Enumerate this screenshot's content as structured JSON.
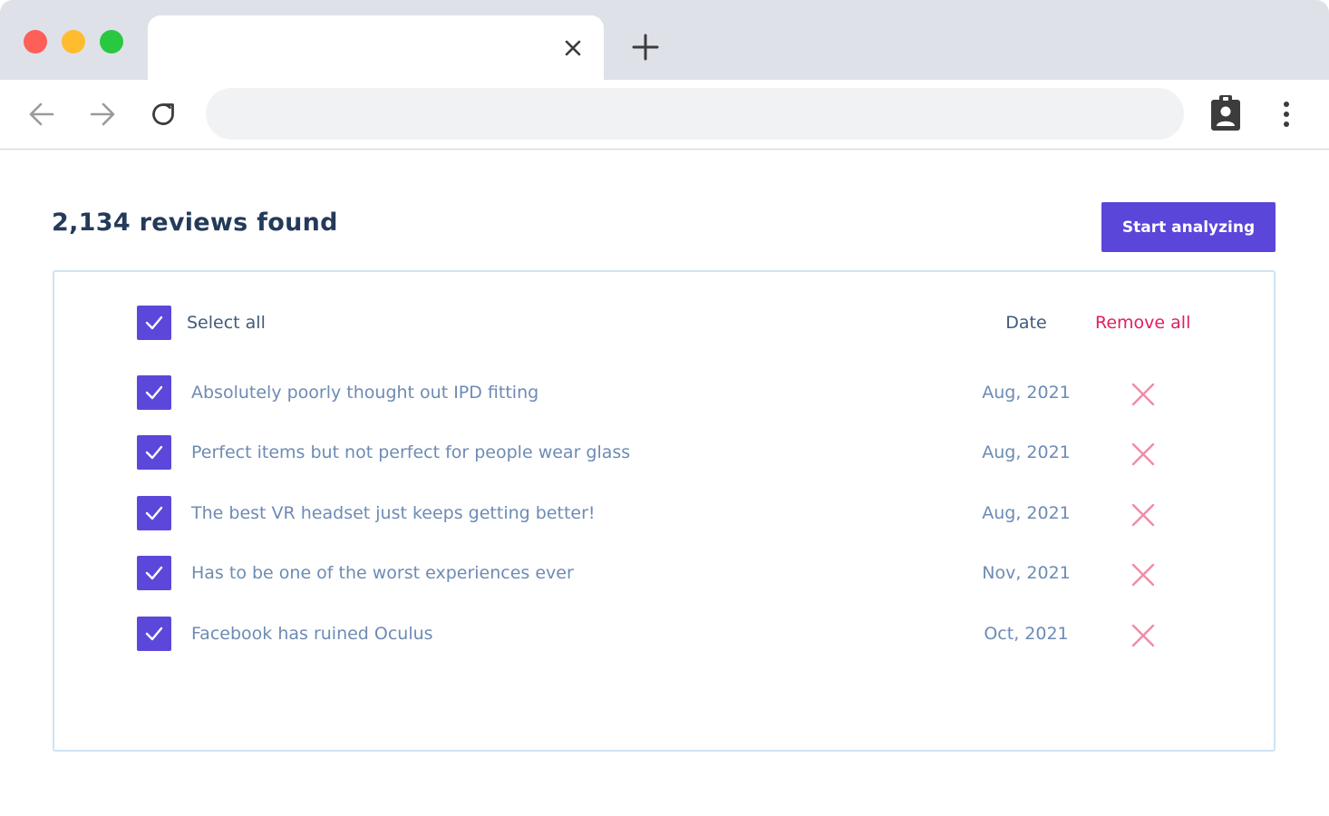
{
  "browser": {
    "tab_title": "",
    "address_value": "",
    "address_placeholder": ""
  },
  "page": {
    "heading": "2,134 reviews found",
    "start_button_label": "Start analyzing"
  },
  "table": {
    "select_all_label": "Select all",
    "date_header": "Date",
    "remove_all_label": "Remove all",
    "rows": [
      {
        "title": "Absolutely poorly thought out IPD fitting",
        "date": "Aug, 2021",
        "checked": true
      },
      {
        "title": "Perfect items but not perfect for people wear glass",
        "date": "Aug, 2021",
        "checked": true
      },
      {
        "title": "The best VR headset just keeps getting better!",
        "date": "Aug, 2021",
        "checked": true
      },
      {
        "title": "Has to be one of the worst experiences ever",
        "date": "Nov, 2021",
        "checked": true
      },
      {
        "title": "Facebook has ruined Oculus",
        "date": "Oct, 2021",
        "checked": true
      }
    ]
  },
  "colors": {
    "accent": "#5a46d9",
    "danger": "#e21f5b",
    "remove_icon": "#f28aa6",
    "heading": "#243a5a",
    "row_text": "#6d8bb4"
  },
  "icons": {
    "window_controls": [
      "close-dot",
      "minimize-dot",
      "maximize-dot"
    ],
    "tab_close": "close-icon",
    "new_tab": "plus-icon",
    "back": "arrow-left-icon",
    "forward": "arrow-right-icon",
    "reload": "reload-icon",
    "profile": "clipboard-user-icon",
    "menu": "vertical-dots-icon",
    "checkbox": "checkmark-icon",
    "remove": "x-icon"
  }
}
